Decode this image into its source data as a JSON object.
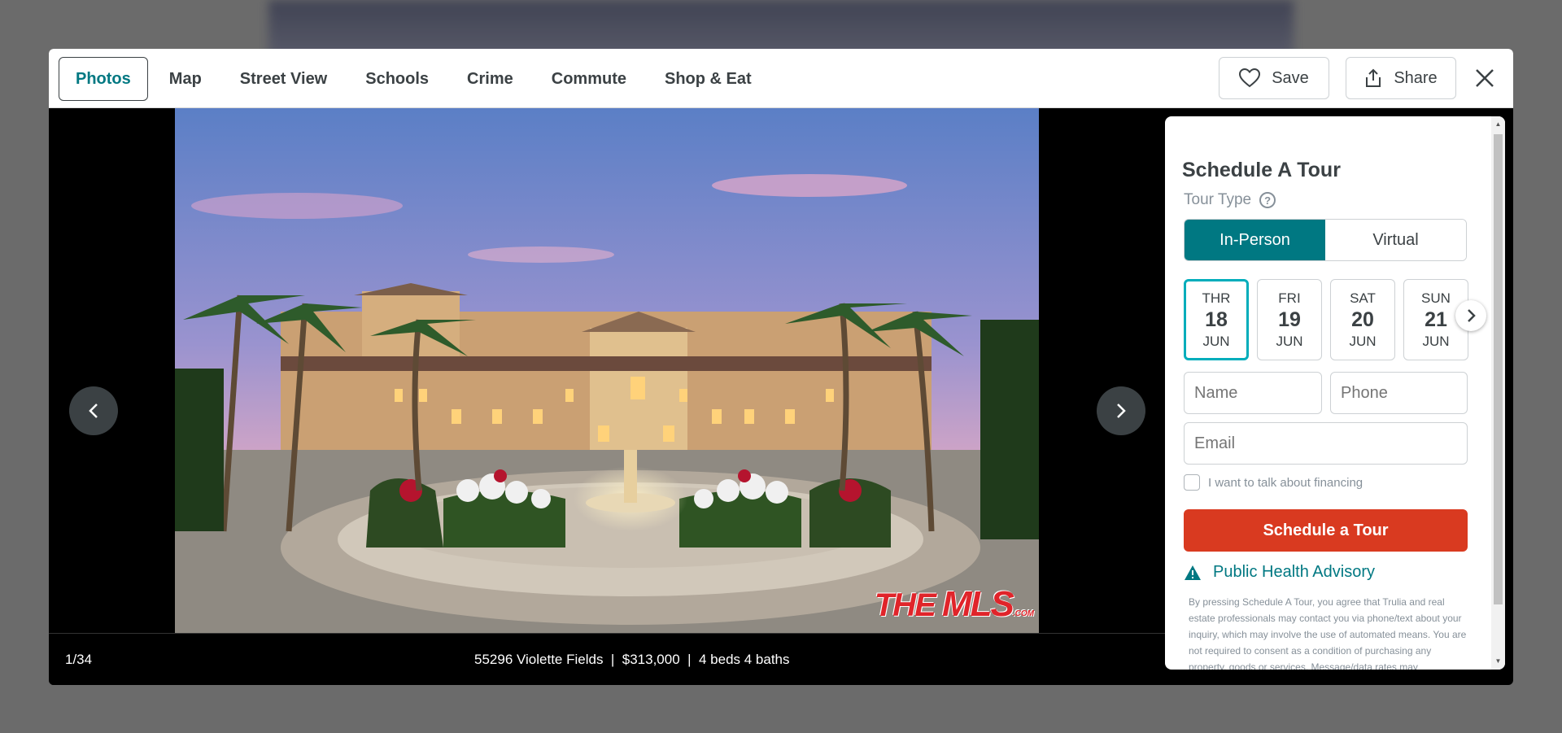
{
  "tabs": [
    {
      "label": "Photos",
      "active": true
    },
    {
      "label": "Map"
    },
    {
      "label": "Street View"
    },
    {
      "label": "Schools"
    },
    {
      "label": "Crime"
    },
    {
      "label": "Commute"
    },
    {
      "label": "Shop & Eat"
    }
  ],
  "actions": {
    "save_label": "Save",
    "share_label": "Share"
  },
  "viewer": {
    "counter": "1/34",
    "info": "55296 Violette Fields  |  $313,000  |  4 beds 4 baths",
    "watermark_text": "THE MLS .COM"
  },
  "tour": {
    "title": "Schedule A Tour",
    "tour_type_label": "Tour Type",
    "help_glyph": "?",
    "in_person": "In-Person",
    "virtual": "Virtual",
    "dates": [
      {
        "dow": "THR",
        "day": "18",
        "month": "JUN"
      },
      {
        "dow": "FRI",
        "day": "19",
        "month": "JUN"
      },
      {
        "dow": "SAT",
        "day": "20",
        "month": "JUN"
      },
      {
        "dow": "SUN",
        "day": "21",
        "month": "JUN"
      }
    ],
    "name_placeholder": "Name",
    "phone_placeholder": "Phone",
    "email_placeholder": "Email",
    "financing_label": "I want to talk about financing",
    "submit_label": "Schedule a Tour",
    "advisory_label": "Public Health Advisory",
    "legal": "By pressing Schedule A Tour, you agree that Trulia and real estate professionals may contact you via phone/text about your inquiry, which may involve the use of automated means. You are not required to consent as a condition of purchasing any property, goods or services. Message/data rates may"
  },
  "colors": {
    "accent": "#007882",
    "cta": "#d93a20",
    "date_selected_border": "#00adbb"
  }
}
